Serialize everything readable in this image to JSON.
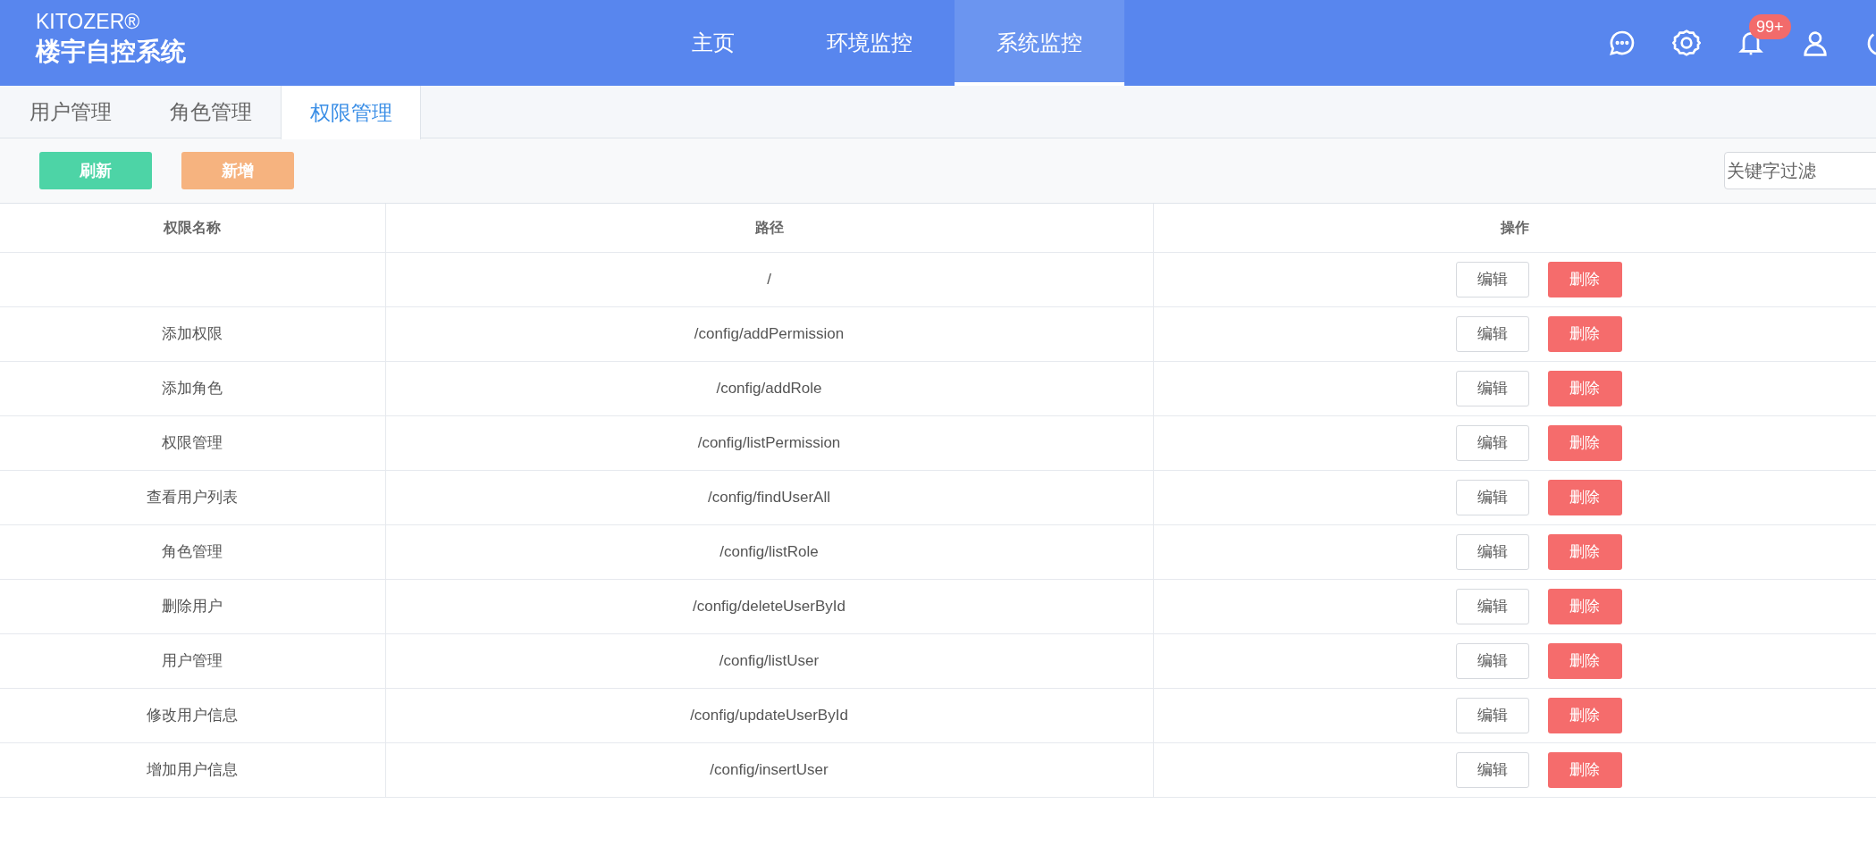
{
  "brand": {
    "name": "KITOZER®",
    "title": "楼宇自控系统"
  },
  "nav": [
    {
      "label": "主页",
      "selected": false
    },
    {
      "label": "环境监控",
      "selected": false
    },
    {
      "label": "系统监控",
      "selected": true
    }
  ],
  "notifications": {
    "badge": "99+"
  },
  "tabs": [
    {
      "label": "用户管理",
      "selected": false
    },
    {
      "label": "角色管理",
      "selected": false
    },
    {
      "label": "权限管理",
      "selected": true
    }
  ],
  "toolbar": {
    "buttons": [
      {
        "label": "刷新",
        "kind": "refresh"
      },
      {
        "label": "新增",
        "kind": "add"
      }
    ],
    "search": {
      "placeholder": "关键字过滤"
    }
  },
  "table": {
    "columns": [
      "权限名称",
      "路径",
      "操作"
    ],
    "rows": [
      {
        "name": "",
        "path": "/",
        "actions": [
          "编辑",
          "删除"
        ]
      },
      {
        "name": "添加权限",
        "path": "/config/addPermission",
        "actions": [
          "编辑",
          "删除"
        ]
      },
      {
        "name": "添加角色",
        "path": "/config/addRole",
        "actions": [
          "编辑",
          "删除"
        ]
      },
      {
        "name": "权限管理",
        "path": "/config/listPermission",
        "actions": [
          "编辑",
          "删除"
        ]
      },
      {
        "name": "查看用户列表",
        "path": "/config/findUserAll",
        "actions": [
          "编辑",
          "删除"
        ]
      },
      {
        "name": "角色管理",
        "path": "/config/listRole",
        "actions": [
          "编辑",
          "删除"
        ]
      },
      {
        "name": "删除用户",
        "path": "/config/deleteUserById",
        "actions": [
          "编辑",
          "删除"
        ]
      },
      {
        "name": "用户管理",
        "path": "/config/listUser",
        "actions": [
          "编辑",
          "删除"
        ]
      },
      {
        "name": "修改用户信息",
        "path": "/config/updateUserById",
        "actions": [
          "编辑",
          "删除"
        ]
      },
      {
        "name": "增加用户信息",
        "path": "/config/insertUser",
        "actions": [
          "编辑",
          "删除"
        ]
      }
    ]
  }
}
